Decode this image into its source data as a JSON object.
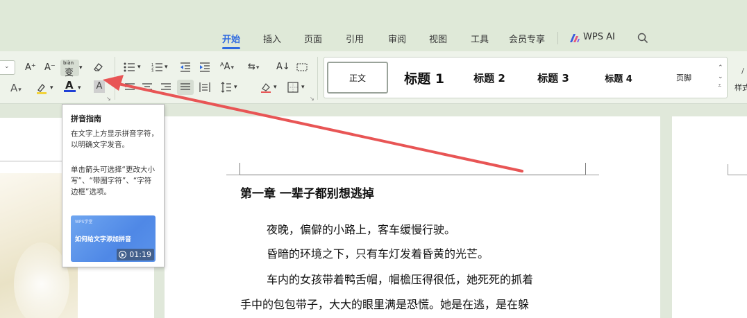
{
  "tabs": [
    {
      "label": "开始",
      "active": true
    },
    {
      "label": "插入"
    },
    {
      "label": "页面"
    },
    {
      "label": "引用"
    },
    {
      "label": "审阅"
    },
    {
      "label": "视图"
    },
    {
      "label": "工具"
    },
    {
      "label": "会员专享"
    },
    {
      "label": "WPS AI"
    }
  ],
  "ribbon": {
    "grow_font": "A⁺",
    "shrink_font": "A⁻",
    "phonetic_guide_glyph": "变",
    "phonetic_guide_ruby": "biàn",
    "style_button_label": "样式"
  },
  "styles": [
    {
      "label": "正文"
    },
    {
      "label": "标题 1"
    },
    {
      "label": "标题 2"
    },
    {
      "label": "标题 3"
    },
    {
      "label": "标题 4"
    },
    {
      "label": "页脚"
    }
  ],
  "tooltip": {
    "title": "拼音指南",
    "desc": "在文字上方显示拼音字符，以明确文字发音。",
    "note": "单击箭头可选择“更改大小写”、“带圈字符”、“字符边框”选项。",
    "video_brand": "WPS学堂",
    "video_title": "如何给文字添加拼音",
    "video_duration": "01:19"
  },
  "document": {
    "chapter_title": "第一章  一辈子都别想逃掉",
    "paragraphs": [
      "夜晚，偏僻的小路上，客车缓慢行驶。",
      "昏暗的环境之下，只有车灯发着昏黄的光芒。",
      "车内的女孩带着鸭舌帽，帽檐压得很低，她死死的抓着",
      "手中的包包带子，大大的眼里满是恐慌。她是在逃，是在躲"
    ]
  },
  "colors": {
    "accent": "#2f6ae0",
    "arrow": "#e85555",
    "font_color_bar": "#1f3fd6"
  }
}
